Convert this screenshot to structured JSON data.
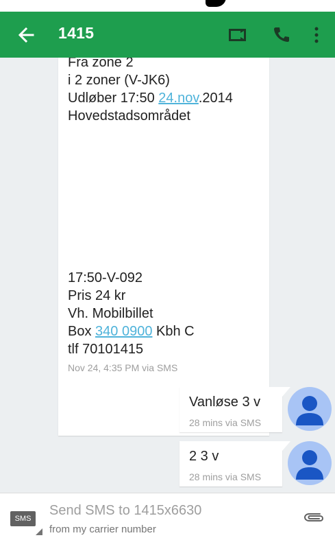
{
  "app_bar": {
    "title": "1415",
    "back_icon": "arrow-back-icon",
    "video_icon": "video-call-icon",
    "call_icon": "phone-icon",
    "more_icon": "more-vert-icon",
    "color": "#1e9e4e"
  },
  "incoming_message": {
    "lines_top": [
      "Fra zone 2",
      "i 2 zoner (V-JK6)"
    ],
    "expiry_prefix": "Udløber 17:50 ",
    "expiry_link": "24.nov",
    "expiry_suffix": ".2014",
    "area": "Hovedstadsområdet",
    "lines_bottom": [
      "17:50-V-092",
      "Pris 24 kr",
      "Vh. Mobilbillet"
    ],
    "box_prefix": "Box ",
    "box_link": "340 0900",
    "box_suffix": " Kbh C",
    "phone_line": "tlf 70101415",
    "meta": "Nov 24, 4:35 PM via SMS",
    "link_color": "#4fb3da"
  },
  "outgoing_messages": [
    {
      "text": "Vanløse 3 v",
      "meta": "28 mins via SMS"
    },
    {
      "text": "2 3 v",
      "meta": "28 mins via SMS"
    }
  ],
  "avatar": {
    "icon": "person-avatar-icon",
    "color": "#a8c4f5"
  },
  "composer": {
    "sms_badge": "SMS",
    "placeholder": "Send SMS to 1415x6630",
    "subtext": "from my carrier number",
    "attach_icon": "paperclip-icon"
  }
}
